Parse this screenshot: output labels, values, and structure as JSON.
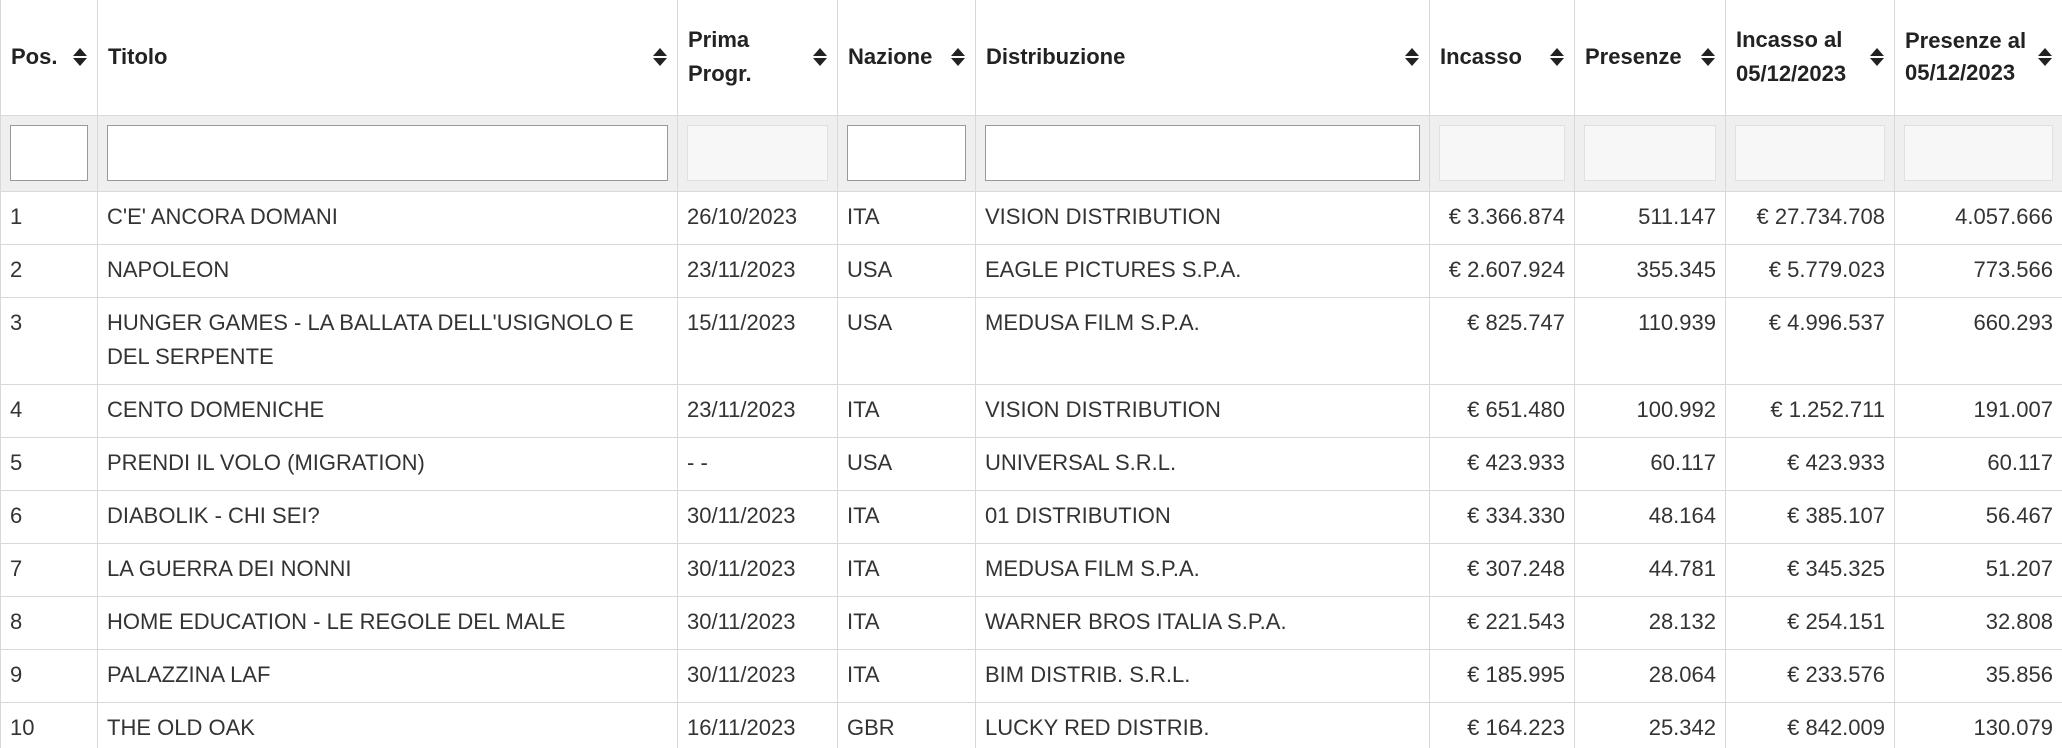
{
  "columns": [
    {
      "key": "pos",
      "label": "Pos."
    },
    {
      "key": "titolo",
      "label": "Titolo"
    },
    {
      "key": "prima",
      "label": "Prima Progr."
    },
    {
      "key": "nazione",
      "label": "Nazione"
    },
    {
      "key": "distribuzione",
      "label": "Distribuzione"
    },
    {
      "key": "incasso",
      "label": "Incasso"
    },
    {
      "key": "presenze",
      "label": "Presenze"
    },
    {
      "key": "incasso_al",
      "label": "Incasso al 05/12/2023"
    },
    {
      "key": "presenze_al",
      "label": "Presenze al 05/12/2023"
    }
  ],
  "filters": {
    "pos": "",
    "titolo": "",
    "prima": "",
    "nazione": "",
    "distribuzione": "",
    "incasso": "",
    "presenze": "",
    "incasso_al": "",
    "presenze_al": ""
  },
  "rows": [
    {
      "pos": "1",
      "titolo": "C'E' ANCORA DOMANI",
      "prima": "26/10/2023",
      "nazione": "ITA",
      "distribuzione": "VISION DISTRIBUTION",
      "incasso": "€ 3.366.874",
      "presenze": "511.147",
      "incasso_al": "€ 27.734.708",
      "presenze_al": "4.057.666"
    },
    {
      "pos": "2",
      "titolo": "NAPOLEON",
      "prima": "23/11/2023",
      "nazione": "USA",
      "distribuzione": "EAGLE PICTURES S.P.A.",
      "incasso": "€ 2.607.924",
      "presenze": "355.345",
      "incasso_al": "€ 5.779.023",
      "presenze_al": "773.566"
    },
    {
      "pos": "3",
      "titolo": "HUNGER GAMES - LA BALLATA DELL'USIGNOLO E DEL SERPENTE",
      "prima": "15/11/2023",
      "nazione": "USA",
      "distribuzione": "MEDUSA FILM S.P.A.",
      "incasso": "€ 825.747",
      "presenze": "110.939",
      "incasso_al": "€ 4.996.537",
      "presenze_al": "660.293"
    },
    {
      "pos": "4",
      "titolo": "CENTO DOMENICHE",
      "prima": "23/11/2023",
      "nazione": "ITA",
      "distribuzione": "VISION DISTRIBUTION",
      "incasso": "€ 651.480",
      "presenze": "100.992",
      "incasso_al": "€ 1.252.711",
      "presenze_al": "191.007"
    },
    {
      "pos": "5",
      "titolo": "PRENDI IL VOLO (MIGRATION)",
      "prima": "- -",
      "nazione": "USA",
      "distribuzione": "UNIVERSAL S.R.L.",
      "incasso": "€ 423.933",
      "presenze": "60.117",
      "incasso_al": "€ 423.933",
      "presenze_al": "60.117"
    },
    {
      "pos": "6",
      "titolo": "DIABOLIK - CHI SEI?",
      "prima": "30/11/2023",
      "nazione": "ITA",
      "distribuzione": "01 DISTRIBUTION",
      "incasso": "€ 334.330",
      "presenze": "48.164",
      "incasso_al": "€ 385.107",
      "presenze_al": "56.467"
    },
    {
      "pos": "7",
      "titolo": "LA GUERRA DEI NONNI",
      "prima": "30/11/2023",
      "nazione": "ITA",
      "distribuzione": "MEDUSA FILM S.P.A.",
      "incasso": "€ 307.248",
      "presenze": "44.781",
      "incasso_al": "€ 345.325",
      "presenze_al": "51.207"
    },
    {
      "pos": "8",
      "titolo": "HOME EDUCATION - LE REGOLE DEL MALE",
      "prima": "30/11/2023",
      "nazione": "ITA",
      "distribuzione": "WARNER BROS ITALIA S.P.A.",
      "incasso": "€ 221.543",
      "presenze": "28.132",
      "incasso_al": "€ 254.151",
      "presenze_al": "32.808"
    },
    {
      "pos": "9",
      "titolo": "PALAZZINA LAF",
      "prima": "30/11/2023",
      "nazione": "ITA",
      "distribuzione": "BIM DISTRIB. S.R.L.",
      "incasso": "€ 185.995",
      "presenze": "28.064",
      "incasso_al": "€ 233.576",
      "presenze_al": "35.856"
    },
    {
      "pos": "10",
      "titolo": "THE OLD OAK",
      "prima": "16/11/2023",
      "nazione": "GBR",
      "distribuzione": "LUCKY RED DISTRIB.",
      "incasso": "€ 164.223",
      "presenze": "25.342",
      "incasso_al": "€ 842.009",
      "presenze_al": "130.079"
    }
  ]
}
